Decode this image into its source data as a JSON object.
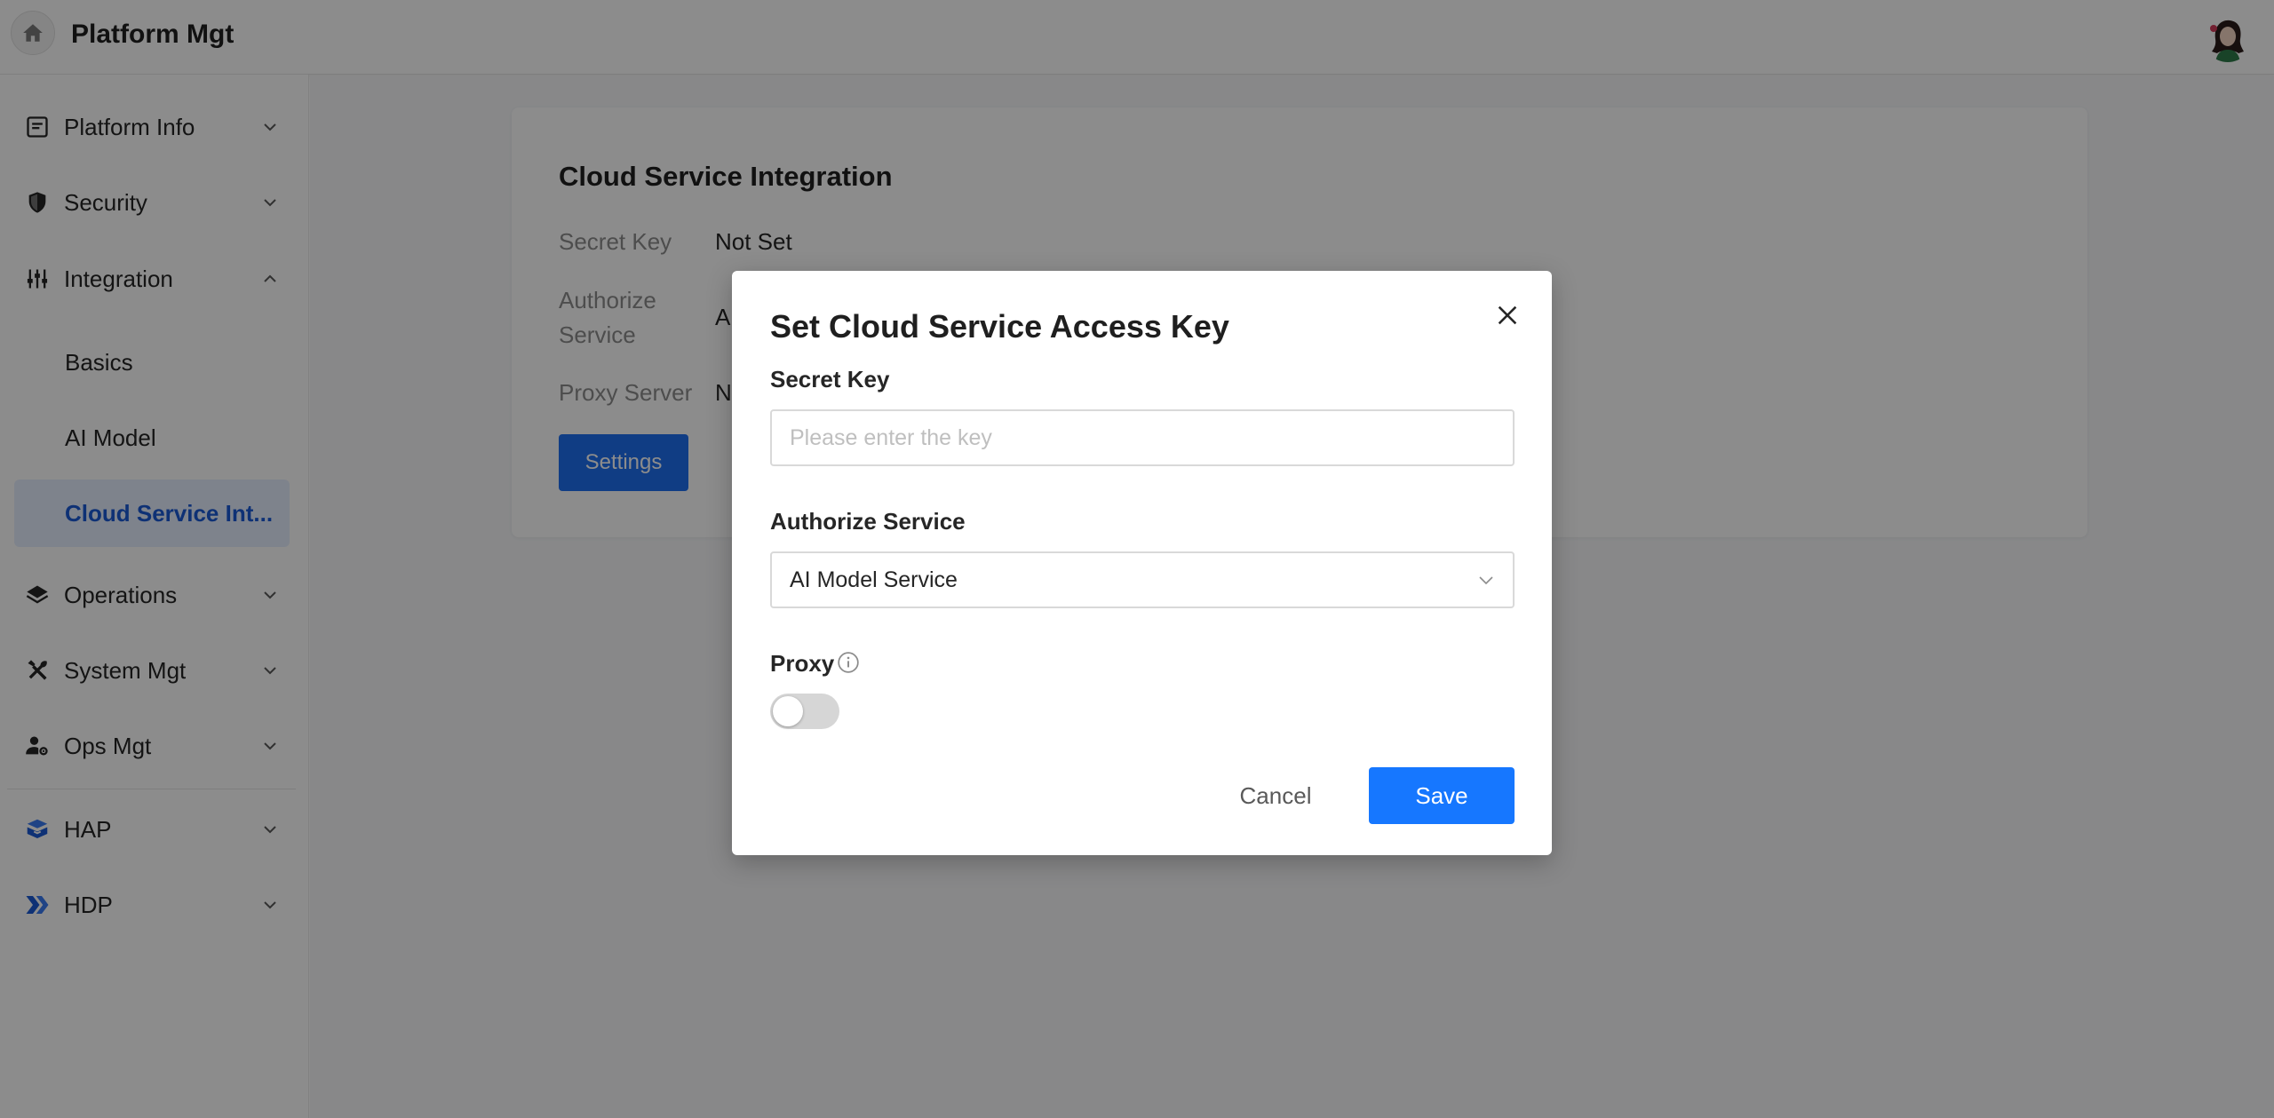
{
  "header": {
    "title": "Platform Mgt",
    "home_icon": "home-icon",
    "avatar_icon": "user-avatar"
  },
  "sidebar": {
    "items": [
      {
        "label": "Platform Info",
        "icon": "document-icon",
        "expanded": false
      },
      {
        "label": "Security",
        "icon": "shield-icon",
        "expanded": false
      },
      {
        "label": "Integration",
        "icon": "sliders-icon",
        "expanded": true,
        "children": [
          {
            "label": "Basics"
          },
          {
            "label": "AI Model"
          },
          {
            "label": "Cloud Service Int...",
            "active": true
          }
        ]
      },
      {
        "label": "Operations",
        "icon": "layers-icon",
        "expanded": false
      },
      {
        "label": "System Mgt",
        "icon": "tools-icon",
        "expanded": false
      },
      {
        "label": "Ops Mgt",
        "icon": "user-gear-icon",
        "expanded": false
      },
      {
        "label": "HAP",
        "icon": "hap-logo-icon",
        "expanded": false
      },
      {
        "label": "HDP",
        "icon": "hdp-logo-icon",
        "expanded": false
      }
    ]
  },
  "main": {
    "card_title": "Cloud Service Integration",
    "fields": [
      {
        "label": "Secret Key",
        "value": "Not Set"
      },
      {
        "label": "Authorize Service",
        "value": "A"
      },
      {
        "label": "Proxy Server",
        "value": "N"
      }
    ],
    "settings_label": "Settings"
  },
  "modal": {
    "title": "Set Cloud Service Access Key",
    "secret_key_label": "Secret Key",
    "secret_key_placeholder": "Please enter the key",
    "secret_key_value": "",
    "authorize_label": "Authorize Service",
    "authorize_value": "AI Model Service",
    "proxy_label": "Proxy",
    "proxy_enabled": false,
    "cancel_label": "Cancel",
    "save_label": "Save"
  },
  "colors": {
    "primary": "#1677ff",
    "active_nav_bg": "#e6efff",
    "active_nav_text": "#1a5ad6",
    "overlay": "rgba(0,0,0,0.45)"
  }
}
